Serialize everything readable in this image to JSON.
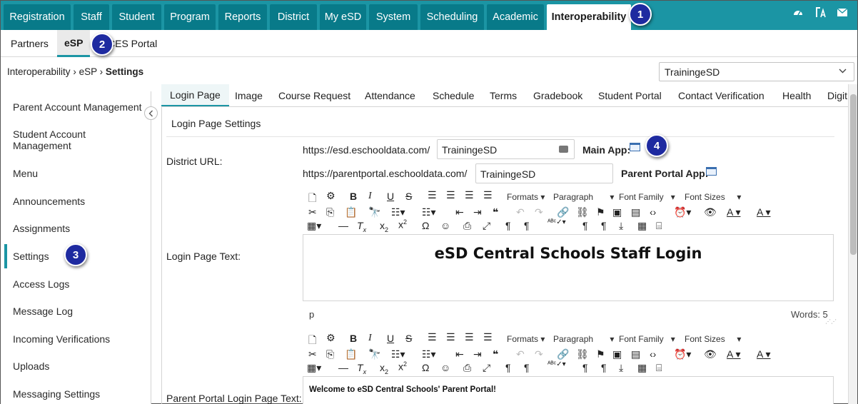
{
  "topnav": {
    "tabs": [
      "Registration",
      "Staff",
      "Student",
      "Program",
      "Reports",
      "District",
      "My eSD",
      "System",
      "Scheduling",
      "Academic",
      "Interoperability"
    ],
    "active": "Interoperability",
    "icons": [
      "dashboard-icon",
      "font-size-icon",
      "mail-icon"
    ]
  },
  "subnav": {
    "items": [
      "Partners",
      "eSP",
      "CES Portal"
    ],
    "active": "eSP"
  },
  "breadcrumb": {
    "part1": "Interoperability",
    "part2": "eSP",
    "current": "Settings",
    "sep": "›"
  },
  "district_select": {
    "value": "TrainingeSD"
  },
  "sidebar": {
    "items": [
      "Parent Account Management",
      "Student Account Management",
      "Menu",
      "Announcements",
      "Assignments",
      "Settings",
      "Access Logs",
      "Message Log",
      "Incoming Verifications",
      "Uploads",
      "Messaging Settings"
    ],
    "active": "Settings"
  },
  "content_tabs": [
    "Login Page",
    "Image",
    "Course Request",
    "Attendance",
    "Schedule",
    "Terms",
    "Gradebook",
    "Student Portal",
    "Contact Verification",
    "Health",
    "Digit"
  ],
  "section": {
    "title": "Login Page Settings",
    "district_url_label": "District URL:",
    "url1_prefix": "https://esd.eschooldata.com/",
    "url1_value": "TrainingeSD",
    "main_app_label": "Main App:",
    "url2_prefix": "https://parentportal.eschooldata.com/",
    "url2_value": "TrainingeSD",
    "parent_app_label": "Parent Portal App:",
    "login_text_label": "Login Page Text:",
    "parent_login_label": "Parent Portal Login Page Text:"
  },
  "editor": {
    "formats": "Formats",
    "paragraph": "Paragraph",
    "font_family": "Font Family",
    "font_sizes": "Font Sizes",
    "content1": "eSD Central Schools Staff Login",
    "status_tag": "p",
    "words": "Words: 5",
    "content2": "Welcome to eSD Central Schools' Parent Portal!"
  },
  "callouts": [
    "1",
    "2",
    "3",
    "4"
  ],
  "colors": {
    "accent": "#1b95a4",
    "tab_dark": "#087a89",
    "badge": "#1e2aa0"
  }
}
